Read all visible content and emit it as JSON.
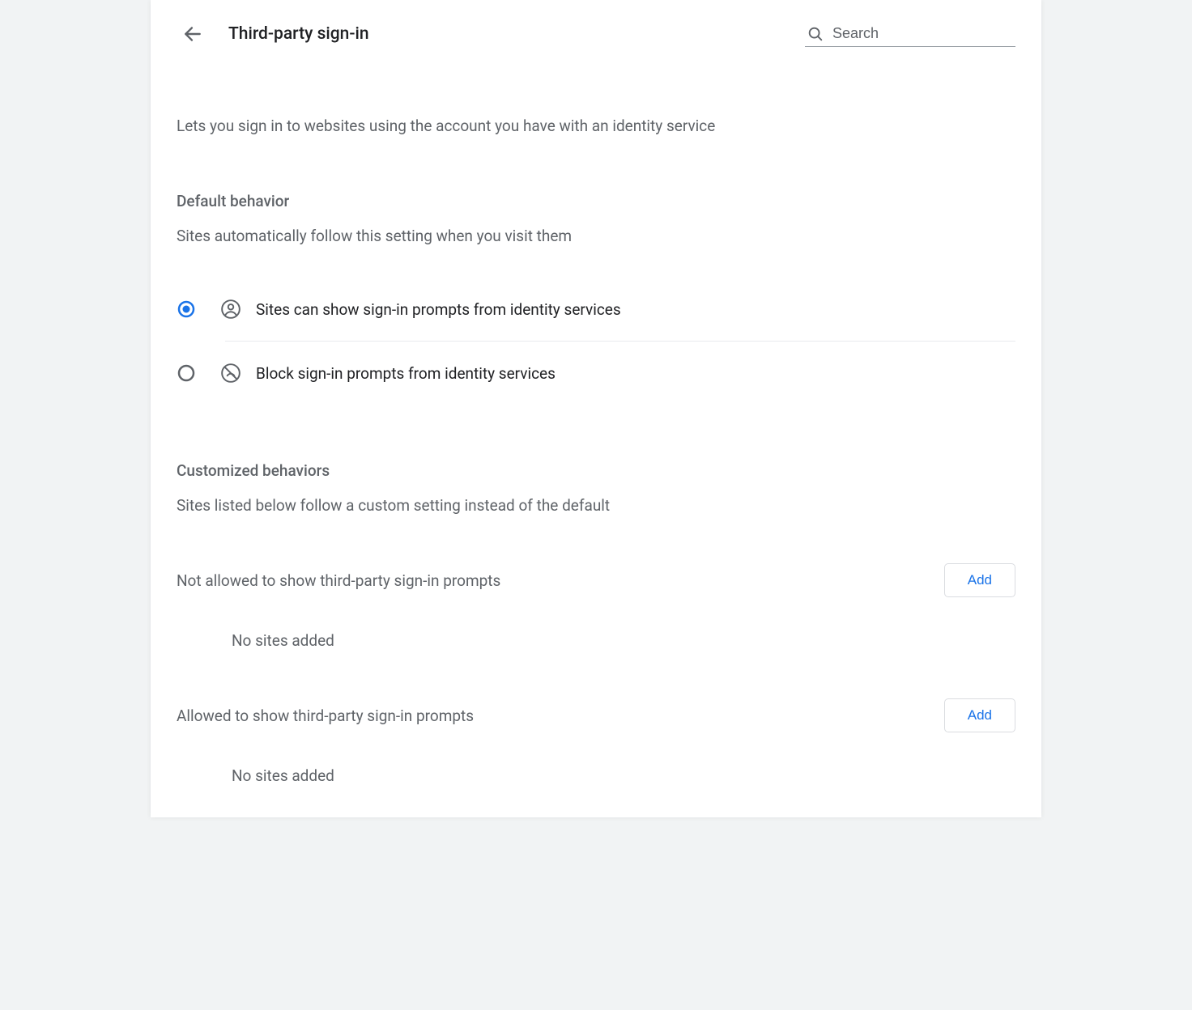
{
  "header": {
    "title": "Third-party sign-in",
    "search_placeholder": "Search"
  },
  "description": "Lets you sign in to websites using the account you have with an identity service",
  "default_behavior": {
    "title": "Default behavior",
    "subtitle": "Sites automatically follow this setting when you visit them",
    "options": [
      {
        "label": "Sites can show sign-in prompts from identity services",
        "selected": true
      },
      {
        "label": "Block sign-in prompts from identity services",
        "selected": false
      }
    ]
  },
  "customized": {
    "title": "Customized behaviors",
    "subtitle": "Sites listed below follow a custom setting instead of the default",
    "not_allowed": {
      "label": "Not allowed to show third-party sign-in prompts",
      "add_label": "Add",
      "empty": "No sites added"
    },
    "allowed": {
      "label": "Allowed to show third-party sign-in prompts",
      "add_label": "Add",
      "empty": "No sites added"
    }
  }
}
